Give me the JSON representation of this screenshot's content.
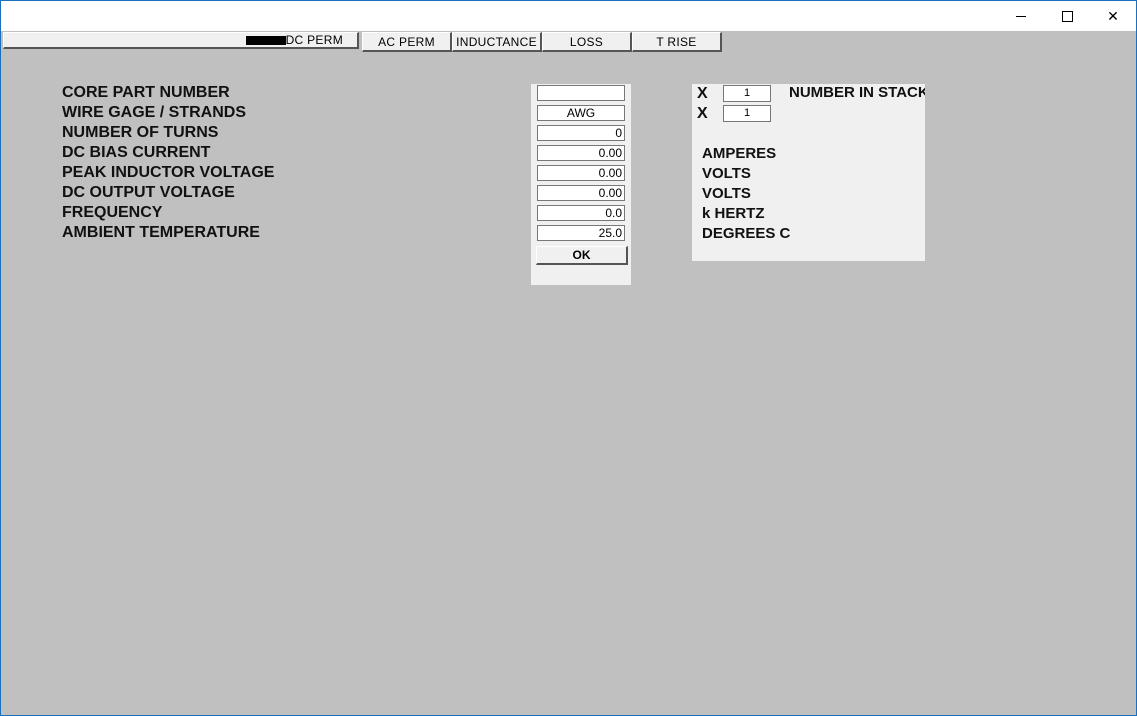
{
  "titlebar": {
    "minimize_icon": "minimize-icon",
    "maximize_icon": "maximize-icon",
    "close_icon": "close-icon",
    "close_glyph": "✕"
  },
  "tabs": [
    {
      "label": "DC PERM"
    },
    {
      "label": "AC PERM"
    },
    {
      "label": "INDUCTANCE"
    },
    {
      "label": "LOSS"
    },
    {
      "label": "T RISE"
    }
  ],
  "form": {
    "labels": [
      "CORE PART NUMBER",
      "WIRE GAGE /  STRANDS",
      "NUMBER OF TURNS",
      "DC BIAS CURRENT",
      "PEAK INDUCTOR VOLTAGE",
      "DC OUTPUT VOLTAGE",
      "FREQUENCY",
      "AMBIENT TEMPERATURE"
    ],
    "values": {
      "core_part_number": "",
      "wire_gage": "AWG",
      "number_of_turns": "0",
      "dc_bias_current": "0.00",
      "peak_inductor_voltage": "0.00",
      "dc_output_voltage": "0.00",
      "frequency": "0.0",
      "ambient_temperature": "25.0"
    },
    "ok_label": "OK"
  },
  "right": {
    "x_label": "X",
    "stack_count": "1",
    "strands_count": "1",
    "stack_label": "NUMBER IN STACK",
    "units": [
      "AMPERES",
      "VOLTS",
      "VOLTS",
      "k HERTZ",
      "DEGREES C"
    ]
  },
  "colors": {
    "background": "#c0c0c0",
    "panel": "#f0f0f0",
    "window_border": "#1a6fbf"
  }
}
